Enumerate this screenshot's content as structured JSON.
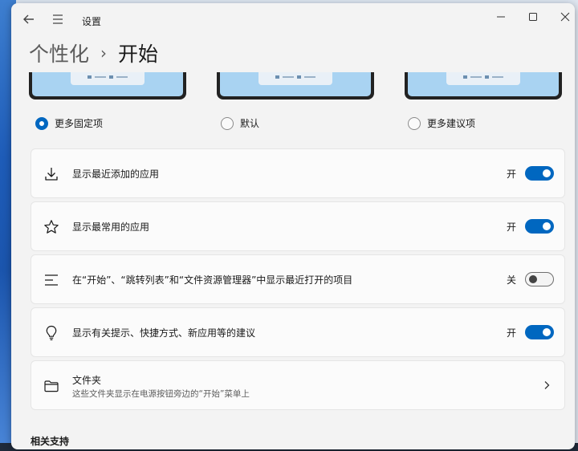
{
  "window": {
    "title": "设置",
    "icons": {
      "back": "arrow-left-icon",
      "menu": "hamburger-menu-icon",
      "minimize": "minimize-icon",
      "maximize": "maximize-icon",
      "close": "close-icon"
    }
  },
  "breadcrumb": {
    "parent": "个性化",
    "separator": "›",
    "current": "开始"
  },
  "layout_options": [
    {
      "label": "更多固定项",
      "selected": true
    },
    {
      "label": "默认",
      "selected": false
    },
    {
      "label": "更多建议项",
      "selected": false
    }
  ],
  "settings": [
    {
      "icon": "download-icon",
      "label": "显示最近添加的应用",
      "state_text": "开",
      "on": true
    },
    {
      "icon": "star-icon",
      "label": "显示最常用的应用",
      "state_text": "开",
      "on": true
    },
    {
      "icon": "list-icon",
      "label": "在“开始”、“跳转列表”和“文件资源管理器”中显示最近打开的项目",
      "state_text": "关",
      "on": false
    },
    {
      "icon": "lightbulb-icon",
      "label": "显示有关提示、快捷方式、新应用等的建议",
      "state_text": "开",
      "on": true
    }
  ],
  "folders": {
    "icon": "folder-icon",
    "title": "文件夹",
    "subtitle": "这些文件夹显示在电源按钮旁边的“开始”菜单上"
  },
  "related": {
    "title": "相关支持"
  },
  "colors": {
    "accent": "#0067c0",
    "card": "#fbfbfb",
    "window": "#f3f3f3"
  }
}
